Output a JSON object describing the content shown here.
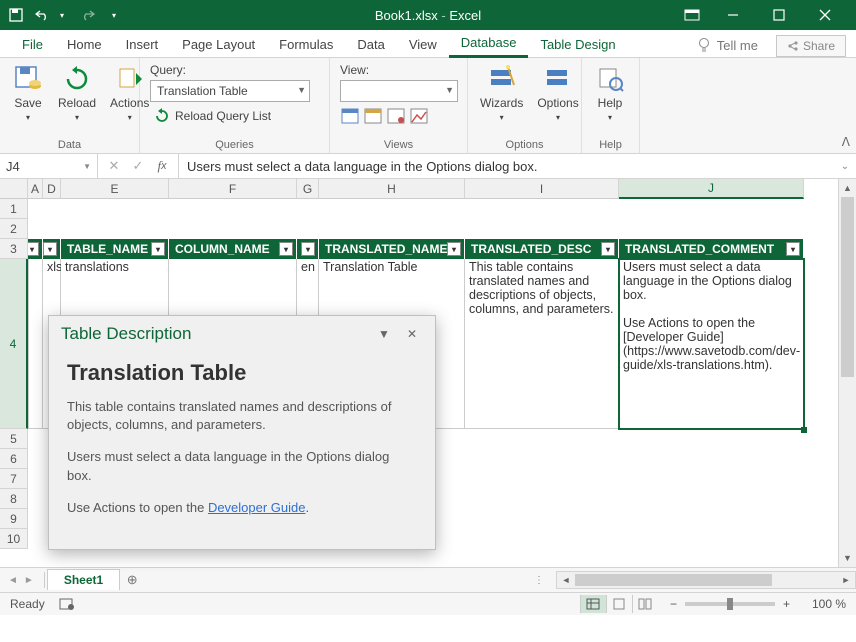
{
  "titlebar": {
    "filename": "Book1.xlsx",
    "app": "Excel"
  },
  "menu": {
    "file": "File",
    "home": "Home",
    "insert": "Insert",
    "pagelayout": "Page Layout",
    "formulas": "Formulas",
    "data": "Data",
    "view": "View",
    "database": "Database",
    "tabledesign": "Table Design",
    "tellme": "Tell me",
    "share": "Share"
  },
  "ribbon": {
    "data_group": "Data",
    "save": "Save",
    "reload": "Reload",
    "actions": "Actions",
    "query_label": "Query:",
    "query_value": "Translation Table",
    "reload_query": "Reload Query List",
    "queries_group": "Queries",
    "view_label": "View:",
    "view_value": "",
    "views_group": "Views",
    "wizards": "Wizards",
    "options": "Options",
    "options_group": "Options",
    "help": "Help",
    "help_group": "Help"
  },
  "formula": {
    "cellref": "J4",
    "value": "Users must select a data language in the Options dialog box."
  },
  "columns": {
    "A": "A",
    "D": "D",
    "E": "E",
    "F": "F",
    "G": "G",
    "H": "H",
    "I": "I",
    "J": "J"
  },
  "rows": [
    "1",
    "2",
    "3",
    "4",
    "5",
    "6",
    "7",
    "8",
    "9",
    "10"
  ],
  "table": {
    "headers": {
      "table_name": "TABLE_NAME",
      "column_name": "COLUMN_NAME",
      "translated_name": "TRANSLATED_NAME",
      "translated_desc": "TRANSLATED_DESC",
      "translated_comment": "TRANSLATED_COMMENT"
    },
    "row": {
      "schema": "xls",
      "table_name": "translations",
      "column_name": "",
      "lang": "en",
      "translated_name": "Translation Table",
      "translated_desc": "This table contains translated names and descriptions of objects, columns, and parameters.",
      "translated_comment": "Users must select a data language in the Options dialog box.\n\nUse Actions to open the [Developer Guide](https://www.savetodb.com/dev-guide/xls-translations.htm)."
    }
  },
  "popup": {
    "title": "Table Description",
    "heading": "Translation Table",
    "p1": "This table contains translated names and descriptions of objects, columns, and parameters.",
    "p2": "Users must select a data language in the Options dialog box.",
    "p3_prefix": "Use Actions to open the ",
    "p3_link": "Developer Guide",
    "p3_suffix": "."
  },
  "sheets": {
    "sheet1": "Sheet1"
  },
  "status": {
    "ready": "Ready",
    "zoom": "100 %"
  }
}
